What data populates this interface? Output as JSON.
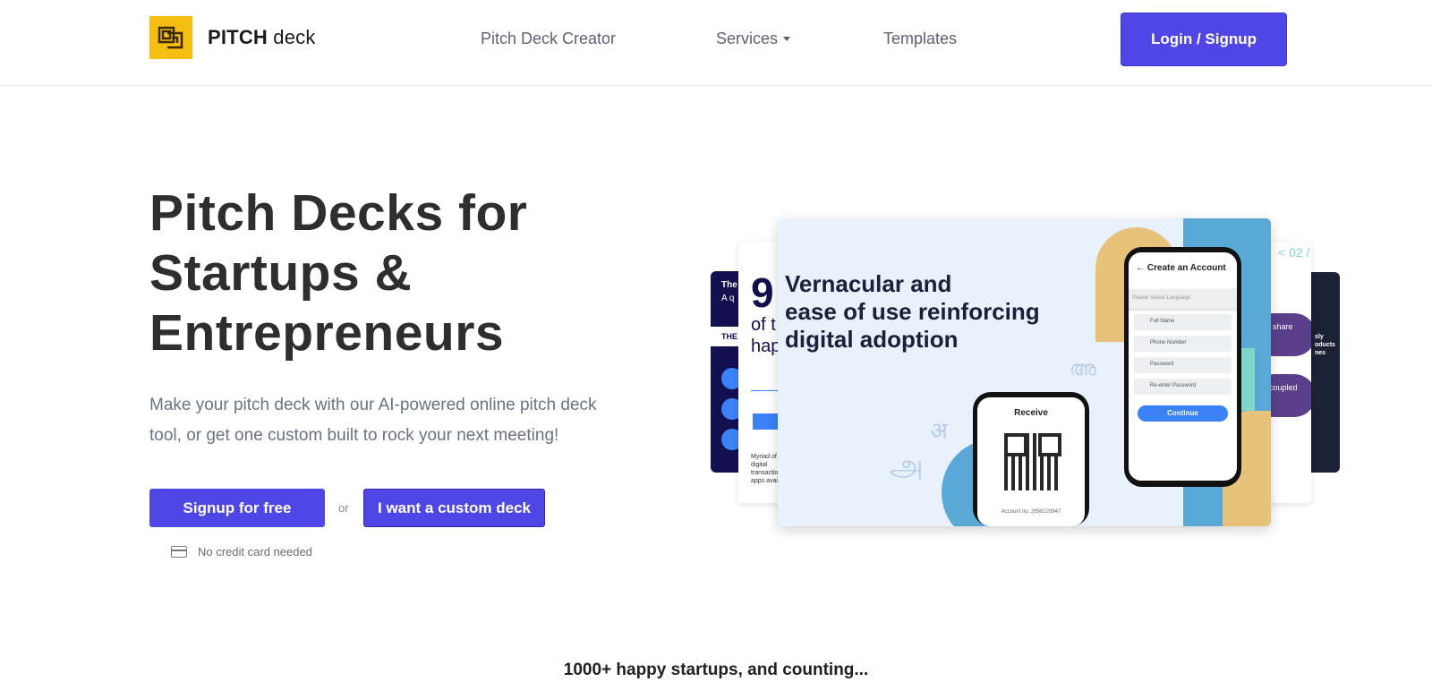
{
  "brand": {
    "name_bold": "PITCH",
    "name_light": " deck",
    "logo_icon": "nested-squares-icon",
    "accent": "#f6bd13"
  },
  "nav": {
    "creator": "Pitch Deck Creator",
    "services": "Services",
    "templates": "Templates",
    "login": "Login / Signup"
  },
  "hero": {
    "title_line1": "Pitch Decks for",
    "title_line2": "Startups &",
    "title_line3": "Entrepreneurs",
    "subtitle_line1": "Make your pitch deck with our AI-powered online pitch deck",
    "subtitle_line2": "tool, or get one custom built to rock your next meeting!",
    "signup_btn": "Signup for free",
    "or_text": "or",
    "custom_btn": "I want a custom deck",
    "no_card": "No credit card needed"
  },
  "slide": {
    "heading_line1": "Vernacular and",
    "heading_line2": "ease of use reinforcing",
    "heading_line3": "digital adoption",
    "phone_big": {
      "title": "Create an Account",
      "select": "Please Select Language",
      "fields": [
        "Full Name",
        "Phone Number",
        "Password",
        "Re-enter Password"
      ],
      "continue": "Continue"
    },
    "phone_small": {
      "title": "Receive",
      "account": "Account no. 2658120947"
    },
    "left_peek": {
      "big_number": "9",
      "line1": "of t",
      "line2": "hap",
      "small1": "The",
      "small2": "A q",
      "small3": "THE",
      "caption": "Myriad of digital transactio apps avail"
    },
    "right_peek": {
      "top": "< 02 /",
      "share": "share",
      "coupled": "coupled",
      "products": "sly oducts nes"
    }
  },
  "colors": {
    "primary": "#4f46e5",
    "text_dark": "#2e2e2e",
    "text_muted": "#6b7280"
  },
  "footer": {
    "tagline": "1000+ happy startups, and counting..."
  }
}
